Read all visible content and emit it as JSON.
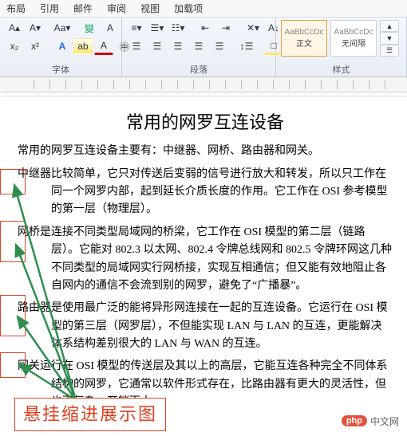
{
  "tabs": {
    "layout": "布局",
    "references": "引用",
    "mailings": "邮件",
    "review": "审阅",
    "view": "视图",
    "addins": "加载项"
  },
  "ribbon": {
    "font_group_label": "字体",
    "paragraph_group_label": "段落",
    "styles_group_label": "样式"
  },
  "styles": {
    "normal_preview": "AaBbCcDc",
    "normal_label": "正文",
    "nospace_preview": "AaBbCcDc",
    "nospace_label": "无间隔"
  },
  "doc": {
    "title": "常用的网罗互连设备",
    "p_intro": "常用的网罗互连设备主要有：中继器、网桥、路由器和网关。",
    "p_repeater": "中继器比较简单，它只对传送后变弱的信号进行放大和转发，所以只工作在同一个网罗内部，起到延长介质长度的作用。它工作在 OSI 参考模型的第一层（物理层）。",
    "p_bridge": "网桥是连接不同类型局域网的桥梁，它工作在 OSI 模型的第二层（链路层）。它能对 802.3 以太网、802.4 令牌总线网和 802.5 令牌环网这几种不同类型的局域网实行网桥接，实现互相通信；但又能有效地阻止各自网内的通信不会流到别的网罗，避免了“广播暴”。",
    "p_router": "路由器是使用最广泛的能将异形网连接在一起的互连设备。它运行在 OSI 模型的第三层（网罗层），不但能实现 LAN 与 LAN 的互连，更能解决体系结构差别很大的 LAN 与 WAN 的互连。",
    "p_gateway": "网关运行在 OSI 模型的传送层及其以上的高层，它能互连各种完全不同体系结构的网罗，它通常以软件形式存在，比路由器有更大的灵活性，但也更复杂、开销更大。"
  },
  "annotation": {
    "caption": "悬挂缩进展示图"
  },
  "brand": {
    "logo": "php",
    "text": "中文网"
  }
}
